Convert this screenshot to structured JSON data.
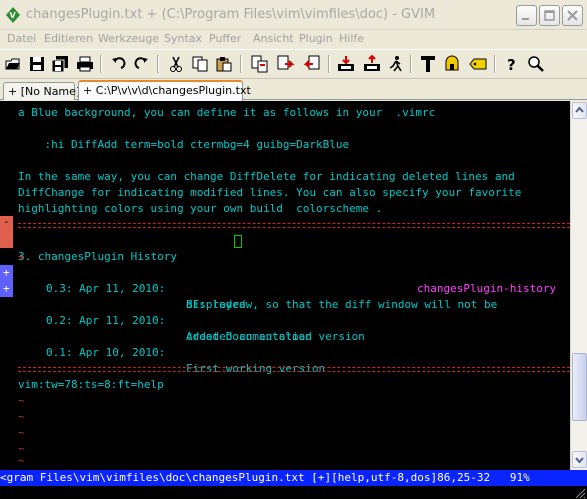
{
  "window": {
    "title": "changesPlugin.txt + (C:\\Program Files\\vim\\vimfiles\\doc) - GVIM",
    "app_icon": "vim-icon",
    "controls": [
      "minimize-icon",
      "maximize-icon",
      "close-icon"
    ]
  },
  "menu": [
    "Datei",
    "Editieren",
    "Werkzeuge",
    "Syntax",
    "Puffer",
    "Ansicht",
    "Plugin",
    "Hilfe"
  ],
  "toolbar": [
    "open-icon",
    "save-icon",
    "save-all-icon",
    "print-icon",
    "undo-icon",
    "redo-icon",
    "cut-icon",
    "copy-icon",
    "paste-icon",
    "find-replace-icon",
    "find-next-icon",
    "find-prev-icon",
    "load-session-icon",
    "save-session-icon",
    "run-script-icon",
    "make-icon",
    "shell-icon",
    "tag-icon",
    "help-icon",
    "find-help-icon"
  ],
  "tabs": [
    {
      "label": "+ [No Name]",
      "active": false
    },
    {
      "label": "+ C:\\P\\v\\v\\d\\changesPlugin.txt",
      "active": true
    }
  ],
  "editor": {
    "lines": [
      {
        "text": "a Blue background, you can define it as follows in your  .vimrc",
        "color": "cyan"
      },
      {
        "text": "",
        "color": "cyan"
      },
      {
        "text": "    :hi DiffAdd term=bold ctermbg=4 guibg=DarkBlue",
        "color": "cyan"
      },
      {
        "text": "",
        "color": "cyan"
      },
      {
        "text": "In the same way, you can change DiffDelete for indicating deleted lines and",
        "color": "cyan"
      },
      {
        "text": "DiffChange for indicating modified lines. You can also specify your favorite",
        "color": "cyan"
      },
      {
        "text": "highlighting colors using your own build  colorscheme .",
        "color": "cyan"
      }
    ],
    "section_heading": "3. changesPlugin History",
    "section_tag": "changesPlugin-history",
    "history_plus": "+",
    "history": [
      {
        "version": "0.3: Apr 11, 2010:",
        "text": "BF: redraw, so that the diff window will not be"
      },
      {
        "version": "",
        "text": "displayed"
      },
      {
        "version": "0.2: Apr 11, 2010:",
        "text": "Added Documentation"
      },
      {
        "version": "",
        "text": "created an autoload version"
      },
      {
        "version": "0.1: Apr 10, 2010:",
        "text": "First working version"
      }
    ],
    "modeline": "vim:tw=78:ts=8:ft=help",
    "tilde": "~",
    "sign_minus": "-",
    "sign_plus": "+"
  },
  "statusline": "<gram Files\\vim\\vimfiles\\doc\\changesPlugin.txt [+][help,utf-8,dos]86,25-32   91%",
  "colors": {
    "text": "#00c8c8",
    "heading_cursor": "#00c800",
    "tag": "#ff40ff",
    "tilde": "#c03030",
    "statusline_bg": "#0a24ff",
    "sign_add": "#6060ff",
    "sign_delete": "#e06050"
  }
}
